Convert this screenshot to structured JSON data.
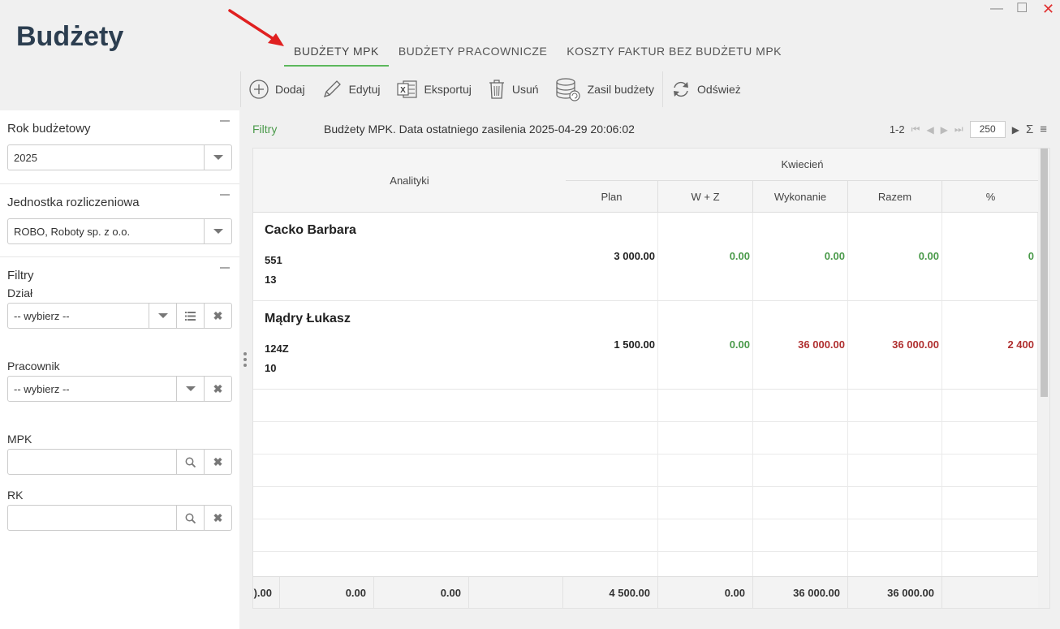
{
  "window": {
    "minimize": "—",
    "maximize": "☐",
    "close": "✕"
  },
  "app": {
    "title": "Budżety"
  },
  "tabs": [
    {
      "label": "BUDŻETY MPK",
      "active": true
    },
    {
      "label": "BUDŻETY PRACOWNICZE",
      "active": false
    },
    {
      "label": "KOSZTY FAKTUR BEZ BUDŻETU MPK",
      "active": false
    }
  ],
  "toolbar": {
    "add": "Dodaj",
    "edit": "Edytuj",
    "export": "Eksportuj",
    "delete": "Usuń",
    "feed": "Zasil budżety",
    "refresh": "Odśwież"
  },
  "sidebar": {
    "year": {
      "label": "Rok budżetowy",
      "value": "2025"
    },
    "unit": {
      "label": "Jednostka rozliczeniowa",
      "value": "ROBO, Roboty sp. z o.o."
    },
    "filters": {
      "label": "Filtry",
      "dzial": {
        "label": "Dział",
        "placeholder": "-- wybierz --"
      },
      "pracownik": {
        "label": "Pracownik",
        "placeholder": "-- wybierz --"
      },
      "mpk": {
        "label": "MPK",
        "value": ""
      },
      "rk": {
        "label": "RK",
        "value": ""
      }
    }
  },
  "grid": {
    "filters_link": "Filtry",
    "title": "Budżety MPK. Data ostatniego zasilenia 2025-04-29 20:06:02",
    "pager": {
      "range": "1-2",
      "page_size": "250"
    },
    "header": {
      "analityki": "Analityki",
      "month": "Kwiecień",
      "columns": [
        "Plan",
        "W + Z",
        "Wykonanie",
        "Razem",
        "%"
      ]
    },
    "rows": [
      {
        "name": "Cacko Barbara",
        "code1": "551",
        "code2": "13",
        "plan": "3 000.00",
        "wz": "0.00",
        "wykonanie": "0.00",
        "razem": "0.00",
        "pct": "0"
      },
      {
        "name": "Mądry Łukasz",
        "code1": "124Z",
        "code2": "10",
        "plan": "1 500.00",
        "wz": "0.00",
        "wykonanie": "36 000.00",
        "razem": "36 000.00",
        "pct": "2 400"
      }
    ],
    "footer": {
      "f1": ").00",
      "f2": "0.00",
      "f3": "0.00",
      "plan": "4 500.00",
      "wz": "0.00",
      "wykonanie": "36 000.00",
      "razem": "36 000.00"
    }
  },
  "colors": {
    "accent": "#5cb85c",
    "positive": "#4a9a4a",
    "negative": "#b03030",
    "arrow": "#e02020"
  }
}
